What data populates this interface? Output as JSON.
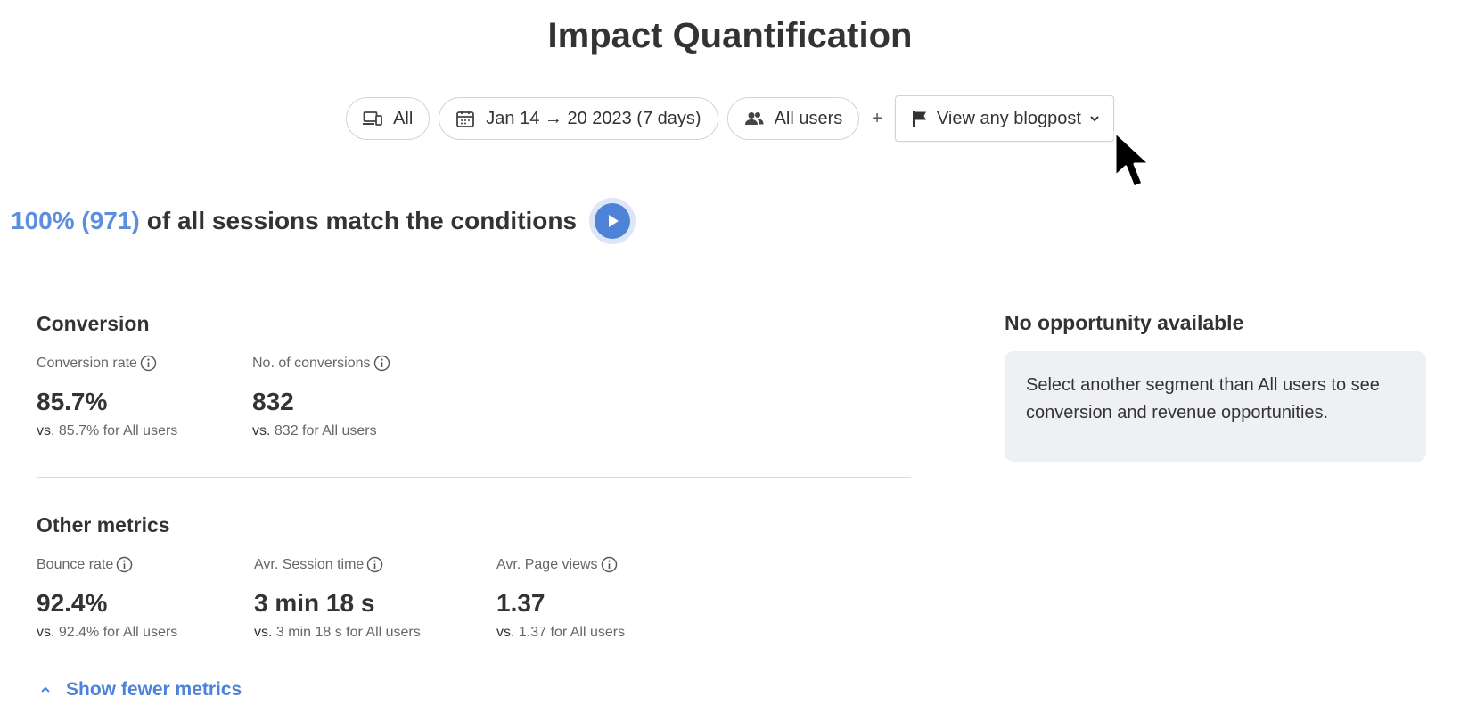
{
  "page": {
    "title": "Impact Quantification"
  },
  "filters": {
    "device": {
      "label": "All",
      "icon": "devices-icon"
    },
    "date": {
      "label": "Jan 14 → 20 2023 (7 days)",
      "icon": "calendar-icon"
    },
    "segment": {
      "label": "All users",
      "icon": "users-icon"
    },
    "plus": "+",
    "goal": {
      "label": "View any blogpost",
      "icon": "flag-icon"
    }
  },
  "sessions": {
    "highlight": "100% (971)",
    "text": "of all sessions match the conditions"
  },
  "conversion": {
    "title": "Conversion",
    "metrics": [
      {
        "label": "Conversion rate",
        "value": "85.7%",
        "vs": "vs.",
        "compare": "85.7% for All users"
      },
      {
        "label": "No. of conversions",
        "value": "832",
        "vs": "vs.",
        "compare": "832 for All users"
      }
    ]
  },
  "other": {
    "title": "Other metrics",
    "metrics": [
      {
        "label": "Bounce rate",
        "value": "92.4%",
        "vs": "vs.",
        "compare": "92.4% for All users"
      },
      {
        "label": "Avr. Session time",
        "value": "3 min 18 s",
        "vs": "vs.",
        "compare": "3 min 18 s for All users"
      },
      {
        "label": "Avr. Page views",
        "value": "1.37",
        "vs": "vs.",
        "compare": "1.37 for All users"
      }
    ]
  },
  "toggle": {
    "label": "Show fewer metrics"
  },
  "opportunity": {
    "title": "No opportunity available",
    "message": "Select another segment than All users to see conversion and revenue opportunities."
  },
  "colors": {
    "accent": "#4d82d8",
    "highlight_text": "#5b8fde",
    "panel_bg": "#eef0f3"
  }
}
